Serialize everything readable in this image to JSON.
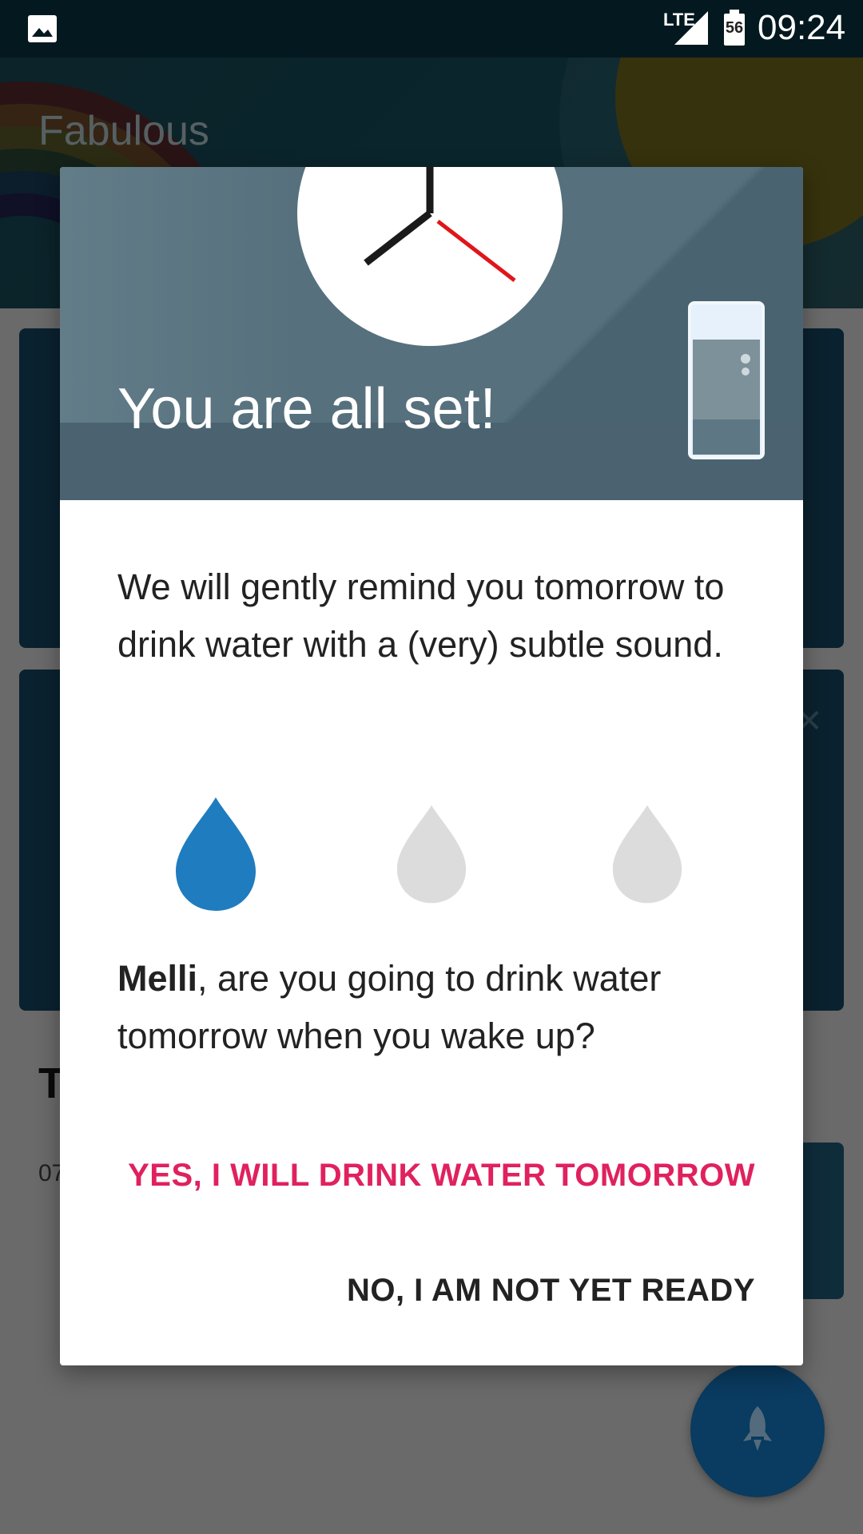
{
  "status_bar": {
    "network": "LTE",
    "battery": "56",
    "time": "09:24",
    "icons": [
      "gallery-icon",
      "signal-icon",
      "battery-icon"
    ]
  },
  "app": {
    "title": "Fabulous",
    "section_letter": "T",
    "section_sub": "07"
  },
  "dialog": {
    "title": "You are all set!",
    "message": "We will gently remind you tomorrow to drink water with a (very) subtle sound.",
    "question_name": "Melli",
    "question_rest": ", are you going to drink water tomorrow when you wake up?",
    "drops": [
      {
        "state": "filled",
        "color": "#1f7cbf"
      },
      {
        "state": "empty",
        "color": "#dcdcdc"
      },
      {
        "state": "empty",
        "color": "#dcdcdc"
      }
    ],
    "yes_label": "YES, I WILL DRINK WATER TOMORROW",
    "no_label": "NO, I AM NOT YET READY"
  },
  "colors": {
    "accent": "#e0215f",
    "hero": "#56707d",
    "fab": "#0d4f80"
  }
}
